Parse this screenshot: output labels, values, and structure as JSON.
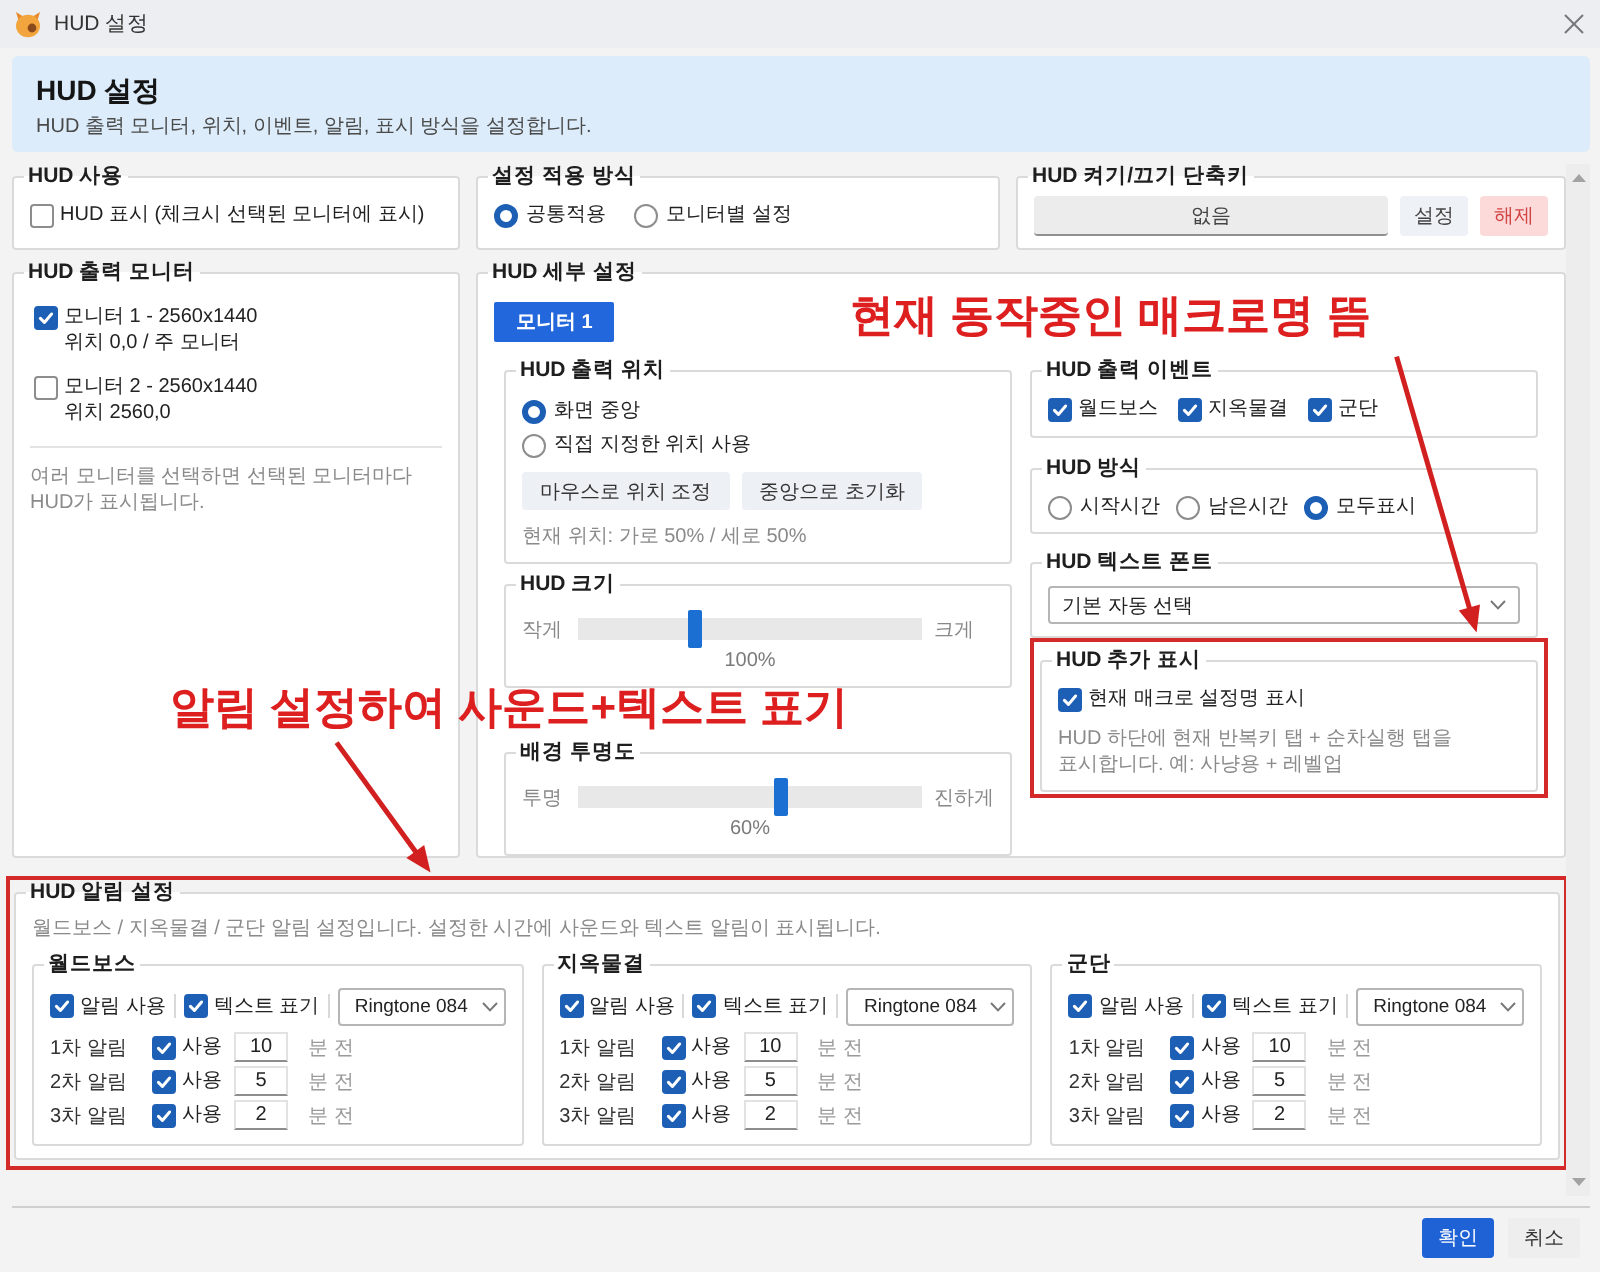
{
  "window": {
    "title": "HUD 설정"
  },
  "header": {
    "title": "HUD 설정",
    "subtitle": "HUD 출력 모니터, 위치, 이벤트, 알림, 표시 방식을 설정합니다."
  },
  "hud_use": {
    "title": "HUD 사용",
    "option": {
      "label": "HUD 표시 (체크시 선택된 모니터에 표시)",
      "checked": false
    }
  },
  "apply_mode": {
    "title": "설정 적용 방식",
    "options": [
      {
        "label": "공통적용",
        "selected": true
      },
      {
        "label": "모니터별 설정",
        "selected": false
      }
    ]
  },
  "hotkey": {
    "title": "HUD 켜기/끄기 단축키",
    "value": "없음",
    "buttons": [
      {
        "label": "설정",
        "kind": "normal"
      },
      {
        "label": "해제",
        "kind": "danger"
      }
    ]
  },
  "output_monitors": {
    "title": "HUD 출력 모니터",
    "monitors": [
      {
        "name": "모니터 1 - 2560x1440",
        "detail": "위치 0,0 / 주 모니터",
        "checked": true
      },
      {
        "name": "모니터 2 - 2560x1440",
        "detail": "위치 2560,0",
        "checked": false
      }
    ],
    "hint": "여러 모니터를 선택하면 선택된 모니터마다 HUD가 표시됩니다."
  },
  "detail": {
    "title": "HUD 세부 설정",
    "tabs": [
      {
        "label": "모니터 1",
        "selected": true
      }
    ],
    "position": {
      "title": "HUD 출력 위치",
      "options": [
        {
          "label": "화면 중앙",
          "selected": true
        },
        {
          "label": "직접 지정한 위치 사용",
          "selected": false
        }
      ],
      "buttons": [
        "마우스로 위치 조정",
        "중앙으로 초기화"
      ],
      "status": "현재 위치: 가로 50% / 세로 50%"
    },
    "sliders": [
      {
        "title": "HUD 크기",
        "min_label": "작게",
        "max_label": "크게",
        "level": 0.34,
        "reading": "100%"
      },
      {
        "title": "배경 투명도",
        "min_label": "투명",
        "max_label": "진하게",
        "level": 0.59,
        "reading": "60%"
      }
    ],
    "events": {
      "title": "HUD 출력 이벤트",
      "items": [
        {
          "label": "월드보스",
          "checked": true
        },
        {
          "label": "지옥물결",
          "checked": true
        },
        {
          "label": "군단",
          "checked": true
        }
      ]
    },
    "display_mode": {
      "title": "HUD 방식",
      "options": [
        {
          "label": "시작시간",
          "selected": false
        },
        {
          "label": "남은시간",
          "selected": false
        },
        {
          "label": "모두표시",
          "selected": true
        }
      ]
    },
    "font": {
      "title": "HUD 텍스트 폰트",
      "value": "기본 자동 선택"
    },
    "extra": {
      "title": "HUD 추가 표시",
      "option": {
        "label": "현재 매크로 설정명 표시",
        "checked": true
      },
      "hint": "HUD 하단에 현재 반복키 탭 + 순차실행 탭을 표시합니다. 예: 사냥용 + 레벨업"
    }
  },
  "alerts": {
    "title": "HUD 알림 설정",
    "hint": "월드보스 / 지옥물결 / 군단 알림 설정입니다. 설정한 시간에 사운드와 텍스트 알림이 표시됩니다.",
    "groups": [
      {
        "title": "월드보스",
        "sound_on": {
          "label": "알림 사용",
          "checked": true
        },
        "text_on": {
          "label": "텍스트 표기",
          "checked": true
        },
        "sound": "Ringtone 084",
        "rows": [
          {
            "label": "1차 알림",
            "use": {
              "label": "사용",
              "checked": true
            },
            "minutes": "10",
            "unit": "분 전"
          },
          {
            "label": "2차 알림",
            "use": {
              "label": "사용",
              "checked": true
            },
            "minutes": "5",
            "unit": "분 전"
          },
          {
            "label": "3차 알림",
            "use": {
              "label": "사용",
              "checked": true
            },
            "minutes": "2",
            "unit": "분 전"
          }
        ]
      },
      {
        "title": "지옥물결",
        "sound_on": {
          "label": "알림 사용",
          "checked": true
        },
        "text_on": {
          "label": "텍스트 표기",
          "checked": true
        },
        "sound": "Ringtone 084",
        "rows": [
          {
            "label": "1차 알림",
            "use": {
              "label": "사용",
              "checked": true
            },
            "minutes": "10",
            "unit": "분 전"
          },
          {
            "label": "2차 알림",
            "use": {
              "label": "사용",
              "checked": true
            },
            "minutes": "5",
            "unit": "분 전"
          },
          {
            "label": "3차 알림",
            "use": {
              "label": "사용",
              "checked": true
            },
            "minutes": "2",
            "unit": "분 전"
          }
        ]
      },
      {
        "title": "군단",
        "sound_on": {
          "label": "알림 사용",
          "checked": true
        },
        "text_on": {
          "label": "텍스트 표기",
          "checked": true
        },
        "sound": "Ringtone 084",
        "rows": [
          {
            "label": "1차 알림",
            "use": {
              "label": "사용",
              "checked": true
            },
            "minutes": "10",
            "unit": "분 전"
          },
          {
            "label": "2차 알림",
            "use": {
              "label": "사용",
              "checked": true
            },
            "minutes": "5",
            "unit": "분 전"
          },
          {
            "label": "3차 알림",
            "use": {
              "label": "사용",
              "checked": true
            },
            "minutes": "2",
            "unit": "분 전"
          }
        ]
      }
    ]
  },
  "footer": {
    "buttons": [
      {
        "label": "확인",
        "kind": "primary"
      },
      {
        "label": "취소",
        "kind": "plain"
      }
    ]
  },
  "annotations": [
    {
      "text": "현재 동작중인 매크로명 뜸"
    },
    {
      "text": "알림 설정하여 사운드+텍스트 표기"
    }
  ]
}
